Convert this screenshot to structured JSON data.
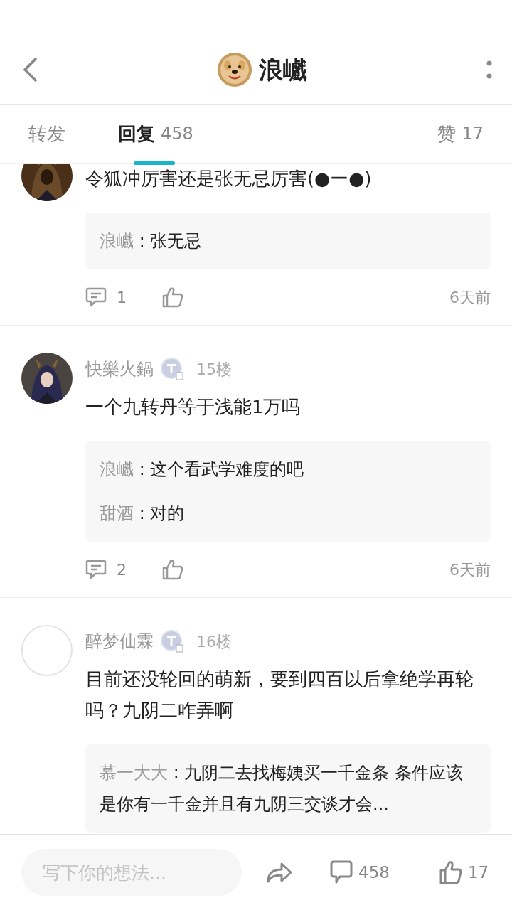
{
  "header": {
    "title": "浪巇"
  },
  "tabs": [
    {
      "label": "转发",
      "selected": false
    },
    {
      "label": "回复",
      "count": "458",
      "selected": true
    },
    {
      "label": "赞",
      "count": "17",
      "selected": false
    }
  ],
  "comments": [
    {
      "avatar": {
        "kind": "picture"
      },
      "text": "令狐冲厉害还是张无忌厉害(●ー●)",
      "replies": [
        {
          "author": "浪巇",
          "text": ": 张无忌"
        }
      ],
      "reply_count": "1",
      "time": "6天前"
    },
    {
      "avatar": {
        "kind": "picture"
      },
      "name": "快樂火鍋",
      "floor": "15楼",
      "text": "一个九转丹等于浅能1万吗",
      "replies": [
        {
          "author": "浪巇",
          "text": ": 这个看武学难度的吧"
        },
        {
          "author": "甜酒",
          "text": ": 对的"
        }
      ],
      "reply_count": "2",
      "time": "6天前"
    },
    {
      "avatar": {
        "kind": "blank"
      },
      "name": "醉梦仙霖",
      "floor": "16楼",
      "text": "目前还没轮回的萌新，要到四百以后拿绝学再轮吗？九阴二咋弄啊",
      "replies": [
        {
          "author": "慕一大大",
          "text": ": 九阴二去找梅姨买一千金条 条件应该是你有一千金并且有九阴三交谈才会..."
        }
      ]
    }
  ],
  "bottom_bar": {
    "placeholder": "写下你的想法...",
    "comment_count": "458",
    "like_count": "17"
  }
}
